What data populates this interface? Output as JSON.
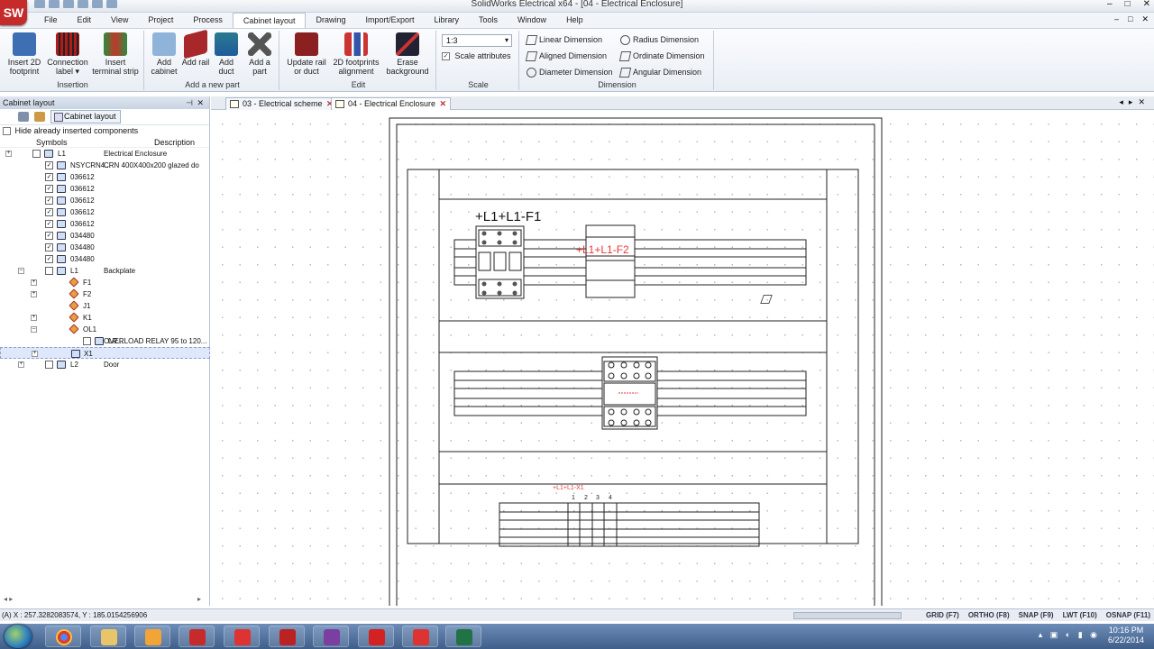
{
  "window": {
    "title": "SolidWorks Electrical x64 - [04 - Electrical Enclosure]",
    "controls": [
      "–",
      "□",
      "✕"
    ],
    "app_badge": "SW"
  },
  "menu": [
    "File",
    "Edit",
    "View",
    "Project",
    "Process",
    "Cabinet layout",
    "Drawing",
    "Import/Export",
    "Library",
    "Tools",
    "Window",
    "Help"
  ],
  "menu_active": "Cabinet layout",
  "ribbon": {
    "insertion": {
      "label": "Insertion",
      "buttons": [
        "Insert 2D footprint",
        "Connection label ▾",
        "Insert terminal strip"
      ]
    },
    "add_part": {
      "label": "Add a new part",
      "buttons": [
        "Add cabinet",
        "Add rail",
        "Add duct",
        "Add a part"
      ]
    },
    "edit": {
      "label": "Edit",
      "buttons": [
        "Update rail or duct",
        "2D footprints alignment",
        "Erase background"
      ]
    },
    "scale": {
      "label": "Scale",
      "value": "1:3",
      "scale_attributes": "Scale attributes"
    },
    "dimension": {
      "label": "Dimension",
      "items": [
        "Linear Dimension",
        "Radius Dimension",
        "Aligned Dimension",
        "Ordinate Dimension",
        "Diameter Dimension",
        "Angular Dimension"
      ]
    }
  },
  "panel": {
    "title": "Cabinet layout",
    "tab": "Cabinet layout",
    "hide_label": "Hide already inserted components",
    "col_symbols": "Symbols",
    "col_description": "Description",
    "tree": [
      {
        "name": "L1",
        "desc": "Electrical Enclosure",
        "depth": 0,
        "exp": "+",
        "chk": ""
      },
      {
        "name": "NSYCRN4...",
        "desc": "CRN 400X400x200 glazed do",
        "depth": 1,
        "chk": "✓"
      },
      {
        "name": "036612",
        "desc": "",
        "depth": 1,
        "chk": "✓"
      },
      {
        "name": "036612",
        "desc": "",
        "depth": 1,
        "chk": "✓"
      },
      {
        "name": "036612",
        "desc": "",
        "depth": 1,
        "chk": "✓"
      },
      {
        "name": "036612",
        "desc": "",
        "depth": 1,
        "chk": "✓"
      },
      {
        "name": "036612",
        "desc": "",
        "depth": 1,
        "chk": "✓"
      },
      {
        "name": "034480",
        "desc": "",
        "depth": 1,
        "chk": "✓"
      },
      {
        "name": "034480",
        "desc": "",
        "depth": 1,
        "chk": "✓"
      },
      {
        "name": "034480",
        "desc": "",
        "depth": 1,
        "chk": "✓"
      },
      {
        "name": "L1",
        "desc": "Backplate",
        "depth": 1,
        "exp": "–",
        "chk": ""
      },
      {
        "name": "F1",
        "desc": "",
        "depth": 2,
        "exp": "+",
        "icon": "red"
      },
      {
        "name": "F2",
        "desc": "",
        "depth": 2,
        "exp": "+",
        "icon": "red"
      },
      {
        "name": "J1",
        "desc": "",
        "depth": 2,
        "icon": "red"
      },
      {
        "name": "K1",
        "desc": "",
        "depth": 2,
        "exp": "+",
        "icon": "red"
      },
      {
        "name": "OL1",
        "desc": "",
        "depth": 2,
        "exp": "–",
        "icon": "red"
      },
      {
        "name": "LR...",
        "desc": "OVERLOAD RELAY 95 to 120...",
        "depth": 3,
        "chk": ""
      },
      {
        "name": "X1",
        "desc": "",
        "depth": 2,
        "exp": "+",
        "sel": true
      },
      {
        "name": "L2",
        "desc": "Door",
        "depth": 1,
        "exp": "+",
        "chk": ""
      }
    ]
  },
  "doc_tabs": [
    {
      "label": "03 - Electrical scheme",
      "active": false
    },
    {
      "label": "04 - Electrical Enclosure",
      "active": true
    }
  ],
  "drawing": {
    "labels": {
      "f1": "+L1+L1-F1",
      "f2": "+L1+L1-F2",
      "x1": "+L1+L1-X1",
      "x1_terms": [
        "1",
        "2",
        "3",
        "4"
      ]
    },
    "colors": {
      "line": "#222222",
      "red_label": "#e8393a"
    }
  },
  "status": {
    "coords": "(A) X : 257.3282083574, Y : 185.0154256906",
    "toggles": [
      "GRID (F7)",
      "ORTHO (F8)",
      "SNAP (F9)",
      "LWT (F10)",
      "OSNAP (F11)"
    ]
  },
  "taskbar": {
    "apps": [
      "chrome",
      "explorer",
      "outlook",
      "solidworks-electrical",
      "solidworks",
      "solidworks-electrical-2",
      "onenote",
      "acrobat",
      "solidworks-2",
      "excel"
    ],
    "time": "10:16 PM",
    "date": "6/22/2014"
  }
}
